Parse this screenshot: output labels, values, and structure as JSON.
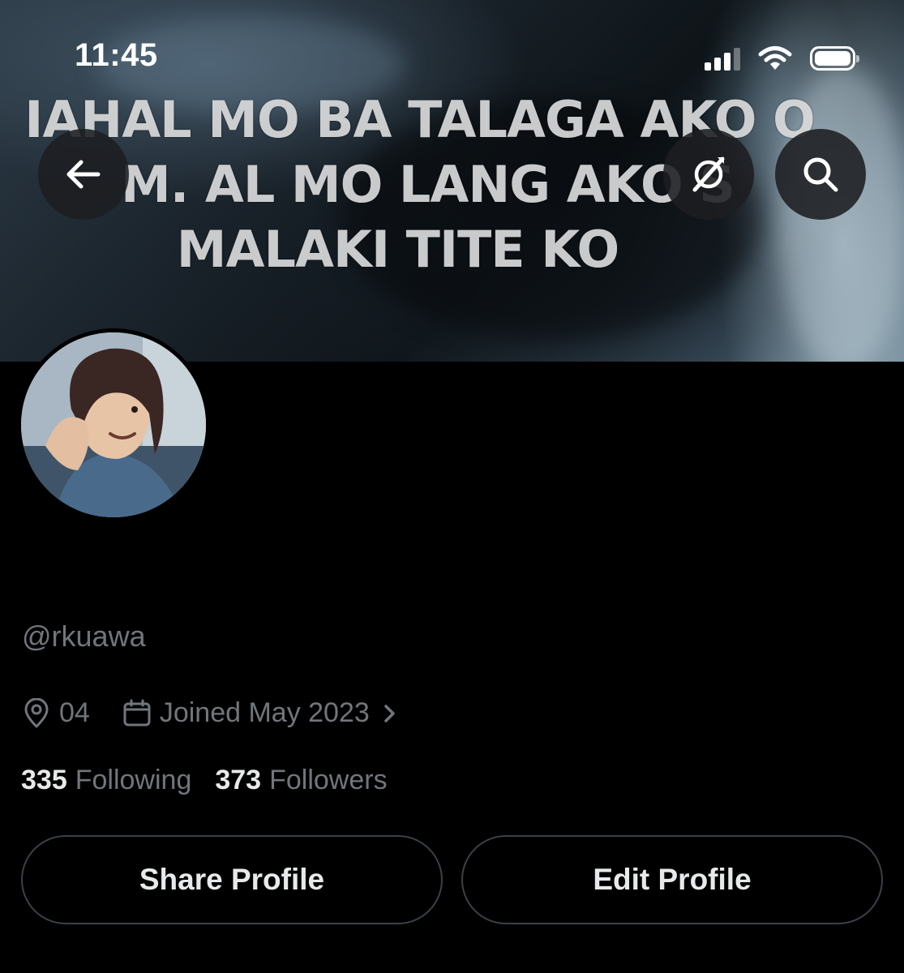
{
  "status_bar": {
    "time": "11:45",
    "signal_bars_active": 3,
    "signal_bars_total": 4,
    "battery_level": 1.0,
    "icons": [
      "cellular-signal-icon",
      "wifi-icon",
      "battery-icon"
    ]
  },
  "banner": {
    "text_lines": [
      "IAHAL MO BA TALAGA AKO O",
      "M.  AL MO LANG AKO     S",
      "MALAKI TITE KO"
    ]
  },
  "nav": {
    "back_icon": "arrow-left-icon",
    "grok_icon": "grok-icon",
    "search_icon": "search-icon"
  },
  "profile": {
    "handle": "@rkuawa",
    "location": "04",
    "joined": "Joined May 2023",
    "following_count": "335",
    "following_label": "Following",
    "followers_count": "373",
    "followers_label": "Followers"
  },
  "actions": {
    "share_label": "Share Profile",
    "edit_label": "Edit Profile"
  },
  "colors": {
    "background": "#000000",
    "primary_text": "#e7e9ea",
    "secondary_text": "#71767b",
    "button_border": "#3b4147",
    "round_button_bg": "#1c1e21"
  }
}
